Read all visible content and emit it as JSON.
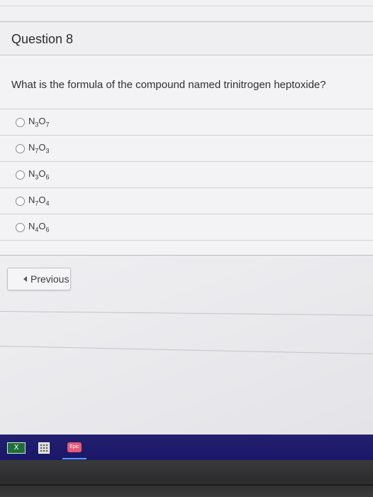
{
  "question": {
    "title": "Question 8",
    "text": "What is the formula of the compound named trinitrogen heptoxide?",
    "options": [
      {
        "label_parts": [
          "N",
          "3",
          "O",
          "7"
        ]
      },
      {
        "label_parts": [
          "N",
          "7",
          "O",
          "3"
        ]
      },
      {
        "label_parts": [
          "N",
          "3",
          "O",
          "6"
        ]
      },
      {
        "label_parts": [
          "N",
          "7",
          "O",
          "4"
        ]
      },
      {
        "label_parts": [
          "N",
          "4",
          "O",
          "6"
        ]
      }
    ]
  },
  "navigation": {
    "previous_label": "Previous"
  },
  "taskbar": {
    "icons": [
      "excel-icon",
      "calculator-icon",
      "epic-app-icon"
    ],
    "excel_glyph": "X",
    "app_label": "Epic",
    "colors": {
      "background": "#1f1b6c",
      "active_underline": "#5a9bff"
    }
  }
}
